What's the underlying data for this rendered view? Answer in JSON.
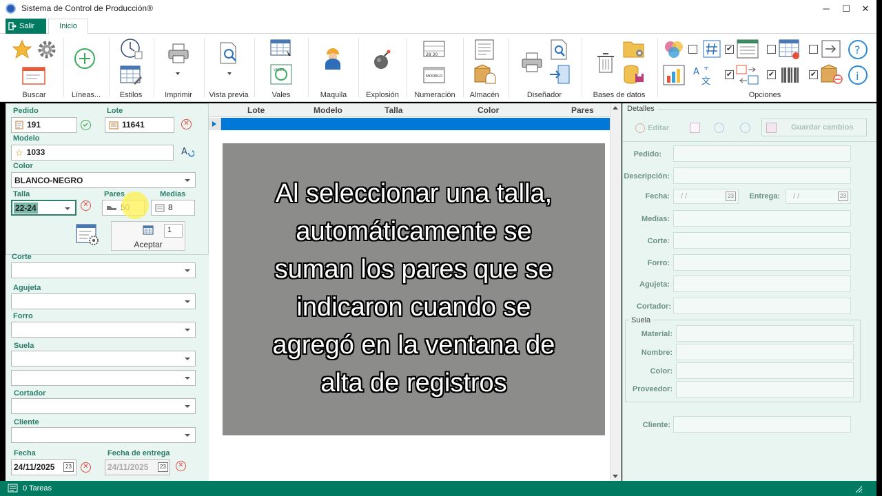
{
  "window": {
    "title": "Sistema de Control de Producción®",
    "minimize": "─",
    "maximize": "☐",
    "close": "✕"
  },
  "tabs": {
    "salir": "Salir",
    "inicio": "Inicio"
  },
  "ribbon": {
    "groups": [
      "Buscar",
      "Líneas...",
      "Estilos",
      "Imprimir",
      "Vista previa",
      "Vales",
      "Maquila",
      "Explosión",
      "Numeración",
      "Almacén",
      "Diseñador",
      "Bases de datos",
      "Opciones"
    ],
    "modelo_tag": "MODELO",
    "vales_tag": "VALES",
    "numeracion_tag": "28 30"
  },
  "form": {
    "pedido_label": "Pedido",
    "pedido": "191",
    "lote_label": "Lote",
    "lote": "11641",
    "modelo_label": "Modelo",
    "modelo": "1033",
    "color_label": "Color",
    "color": "BLANCO-NEGRO",
    "talla_label": "Talla",
    "talla": "22-24",
    "pares_label": "Pares",
    "pares": "50",
    "medias_label": "Medias",
    "medias": "8",
    "cantidad": "1",
    "aceptar": "Aceptar",
    "corte_label": "Corte",
    "agujeta_label": "Agujeta",
    "forro_label": "Forro",
    "suela_label": "Suela",
    "cortador_label": "Cortador",
    "cliente_label": "Cliente",
    "fecha_label": "Fecha",
    "fecha": "24/11/2025",
    "entrega_label": "Fecha de entrega",
    "entrega": "24/11/2025",
    "cal_tag": "23"
  },
  "grid": {
    "columns": [
      "Lote",
      "Modelo",
      "Talla",
      "Color",
      "Pares"
    ],
    "overlay_lines": [
      "Al seleccionar una talla,",
      "automáticamente se",
      "suman los pares que se",
      "indicaron cuando se",
      "agregó en la ventana de",
      "alta de registros"
    ]
  },
  "details": {
    "title": "Detalles",
    "editar": "Editar",
    "guardar": "Guardar cambios",
    "pedido": "Pedido:",
    "descripcion": "Descripción:",
    "fecha": "Fecha:",
    "fecha_val": "/  /",
    "entrega": "Entrega:",
    "entrega_val": "/  /",
    "medias": "Medias:",
    "corte": "Corte:",
    "forro": "Forro:",
    "agujeta": "Agujeta:",
    "cortador": "Cortador:",
    "suela_title": "Suela",
    "material": "Material:",
    "nombre": "Nombre:",
    "color": "Color:",
    "proveedor": "Proveedor:",
    "cliente": "Cliente:"
  },
  "status": {
    "tareas": "0 Tareas"
  },
  "colors": {
    "accent": "#007a60",
    "selection": "#0078d7",
    "overlay": "#8c8c8a"
  }
}
